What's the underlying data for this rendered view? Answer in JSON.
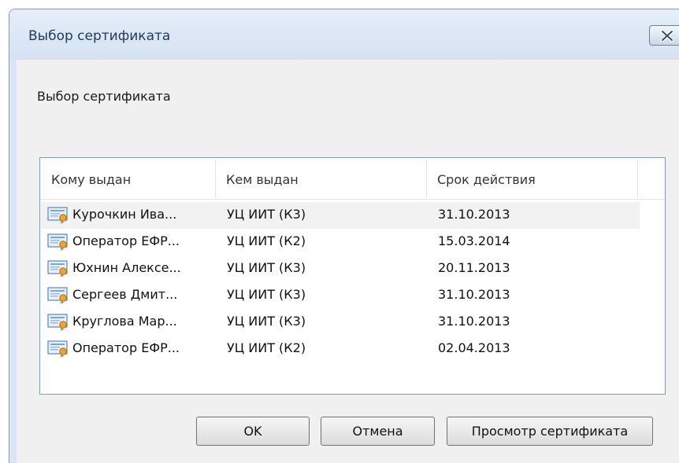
{
  "window": {
    "title": "Выбор сертификата"
  },
  "dialog": {
    "heading": "Выбор сертификата"
  },
  "table": {
    "columns": [
      "Кому выдан",
      "Кем выдан",
      "Срок действия"
    ],
    "rows": [
      {
        "issued_to": "Курочкин Ива...",
        "issued_by": "УЦ ИИТ (К3)",
        "expires": "31.10.2013",
        "selected": true
      },
      {
        "issued_to": "Оператор ЕФР...",
        "issued_by": "УЦ ИИТ (К2)",
        "expires": "15.03.2014"
      },
      {
        "issued_to": "Юхнин Алексе...",
        "issued_by": "УЦ ИИТ (К3)",
        "expires": "20.11.2013"
      },
      {
        "issued_to": "Сергеев Дмит...",
        "issued_by": "УЦ ИИТ (К3)",
        "expires": "31.10.2013"
      },
      {
        "issued_to": "Круглова Мар...",
        "issued_by": "УЦ ИИТ (К3)",
        "expires": "31.10.2013"
      },
      {
        "issued_to": "Оператор ЕФР...",
        "issued_by": "УЦ ИИТ (К2)",
        "expires": "02.04.2013"
      }
    ]
  },
  "buttons": {
    "ok": "OK",
    "cancel": "Отмена",
    "view": "Просмотр сертификата"
  },
  "icons": {
    "close": "close-icon",
    "row": "certificate-icon"
  },
  "colors": {
    "title_text": "#1e395b",
    "frame": "#dbe6f4",
    "client": "#f0f0f0",
    "list_border": "#7f9db9"
  }
}
